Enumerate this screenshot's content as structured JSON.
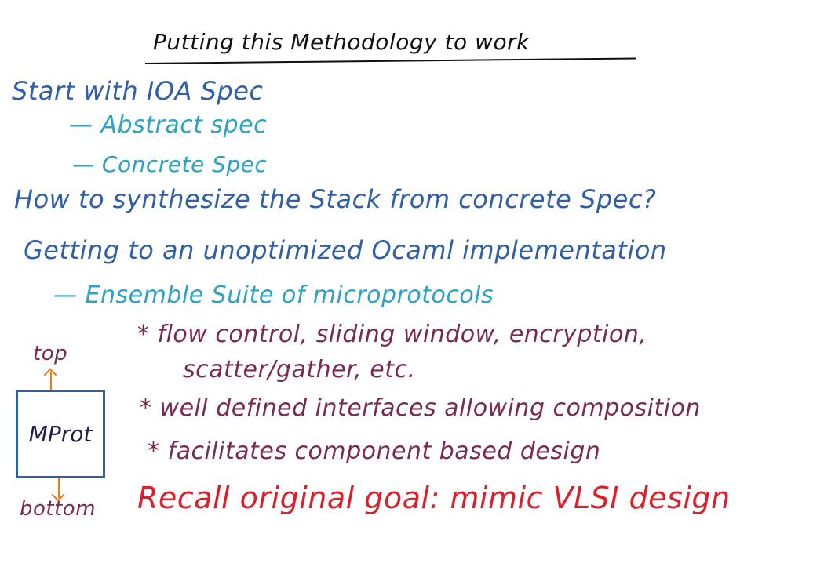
{
  "title": "Putting this Methodology to work",
  "lines": {
    "start": "Start with IOA Spec",
    "abstract": "— Abstract spec",
    "concrete": "— Concrete Spec",
    "synthesize": "How to synthesize the Stack from concrete Spec?",
    "getting": "Getting to an unoptimized Ocaml implementation",
    "ensemble": "— Ensemble Suite of microprotocols",
    "bullet1a": "* flow control, sliding window, encryption,",
    "bullet1b": "scatter/gather, etc.",
    "bullet2": "* well defined interfaces allowing composition",
    "bullet3": "* facilitates component based design",
    "recall": "Recall original goal: mimic VLSI design"
  },
  "diagram": {
    "box_label": "MProt",
    "top_label": "top",
    "bottom_label": "bottom"
  },
  "colors": {
    "title": "#111111",
    "blue": "#2f5fa8",
    "cyan": "#2aa3c8",
    "maroon": "#7a2a52",
    "red": "#e01e2a",
    "orange": "#f07a1a"
  }
}
